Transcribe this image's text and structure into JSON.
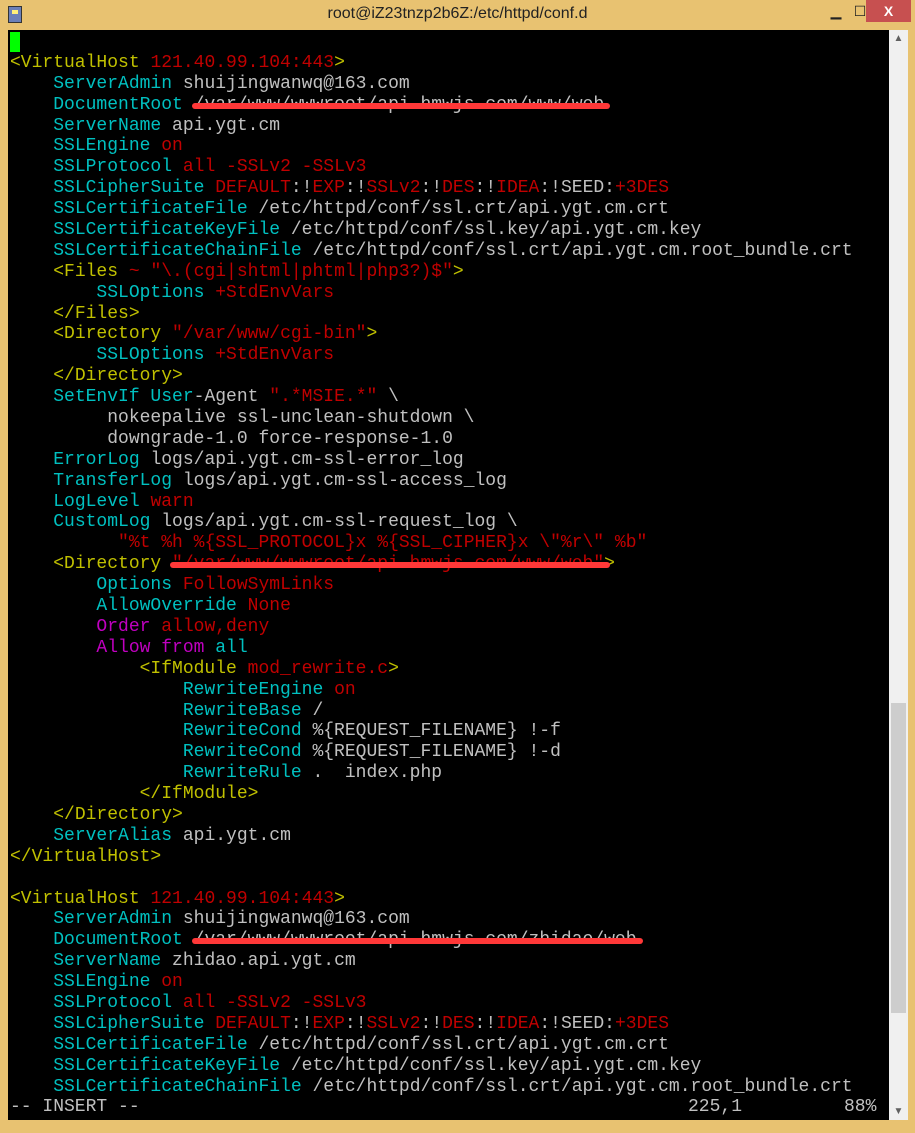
{
  "window": {
    "title": "root@iZ23tnzp2b6Z:/etc/httpd/conf.d",
    "min": "▁",
    "max": "☐",
    "close": "X"
  },
  "colors": {
    "yellow": "#c0c000",
    "red": "#c00000",
    "cyan": "#00c0c0",
    "magenta": "#c000c0",
    "white": "#c0c0c0",
    "cursor": "#00ff00",
    "titlebar": "#e8c271"
  },
  "lines": [
    [
      {
        "c": "cursor",
        "t": ""
      }
    ],
    [
      {
        "c": "y",
        "t": "<VirtualHost "
      },
      {
        "c": "r",
        "t": "121.40.99.104:443"
      },
      {
        "c": "y",
        "t": ">"
      }
    ],
    [
      {
        "c": "w",
        "t": "    "
      },
      {
        "c": "c",
        "t": "ServerAdmin"
      },
      {
        "c": "w",
        "t": " shuijingwanwq@163.com"
      }
    ],
    [
      {
        "c": "w",
        "t": "    "
      },
      {
        "c": "c",
        "t": "DocumentRoot"
      },
      {
        "c": "w",
        "t": " "
      },
      {
        "c": "w red",
        "t": "/var/www/wwwroot/api.hmwjs.com/www/web"
      }
    ],
    [
      {
        "c": "w",
        "t": "    "
      },
      {
        "c": "c",
        "t": "ServerName"
      },
      {
        "c": "w",
        "t": " api.ygt.cm"
      }
    ],
    [
      {
        "c": "w",
        "t": "    "
      },
      {
        "c": "c",
        "t": "SSLEngine"
      },
      {
        "c": "r",
        "t": " on"
      }
    ],
    [
      {
        "c": "w",
        "t": "    "
      },
      {
        "c": "c",
        "t": "SSLProtocol"
      },
      {
        "c": "r",
        "t": " all -SSLv2 -SSLv3"
      }
    ],
    [
      {
        "c": "w",
        "t": "    "
      },
      {
        "c": "c",
        "t": "SSLCipherSuite"
      },
      {
        "c": "r",
        "t": " DEFAULT"
      },
      {
        "c": "w",
        "t": ":!"
      },
      {
        "c": "r",
        "t": "EXP"
      },
      {
        "c": "w",
        "t": ":!"
      },
      {
        "c": "r",
        "t": "SSLv2"
      },
      {
        "c": "w",
        "t": ":!"
      },
      {
        "c": "r",
        "t": "DES"
      },
      {
        "c": "w",
        "t": ":!"
      },
      {
        "c": "r",
        "t": "IDEA"
      },
      {
        "c": "w",
        "t": ":!SEED:"
      },
      {
        "c": "r",
        "t": "+3DES"
      }
    ],
    [
      {
        "c": "w",
        "t": "    "
      },
      {
        "c": "c",
        "t": "SSLCertificateFile"
      },
      {
        "c": "w",
        "t": " /etc/httpd/conf/ssl.crt/api.ygt.cm.crt"
      }
    ],
    [
      {
        "c": "w",
        "t": "    "
      },
      {
        "c": "c",
        "t": "SSLCertificateKeyFile"
      },
      {
        "c": "w",
        "t": " /etc/httpd/conf/ssl.key/api.ygt.cm.key"
      }
    ],
    [
      {
        "c": "w",
        "t": "    "
      },
      {
        "c": "c",
        "t": "SSLCertificateChainFile"
      },
      {
        "c": "w",
        "t": " /etc/httpd/conf/ssl.crt/api.ygt.cm.root_bundle.crt"
      }
    ],
    [
      {
        "c": "w",
        "t": "    "
      },
      {
        "c": "y",
        "t": "<Files "
      },
      {
        "c": "r",
        "t": "~ \"\\.(cgi|shtml|phtml|php3?)$\""
      },
      {
        "c": "y",
        "t": ">"
      }
    ],
    [
      {
        "c": "w",
        "t": "        "
      },
      {
        "c": "c",
        "t": "SSLOptions"
      },
      {
        "c": "r",
        "t": " +StdEnvVars"
      }
    ],
    [
      {
        "c": "w",
        "t": "    "
      },
      {
        "c": "y",
        "t": "</Files>"
      }
    ],
    [
      {
        "c": "w",
        "t": "    "
      },
      {
        "c": "y",
        "t": "<Directory "
      },
      {
        "c": "r",
        "t": "\"/var/www/cgi-bin\""
      },
      {
        "c": "y",
        "t": ">"
      }
    ],
    [
      {
        "c": "w",
        "t": "        "
      },
      {
        "c": "c",
        "t": "SSLOptions"
      },
      {
        "c": "r",
        "t": " +StdEnvVars"
      }
    ],
    [
      {
        "c": "w",
        "t": "    "
      },
      {
        "c": "y",
        "t": "</Directory>"
      }
    ],
    [
      {
        "c": "w",
        "t": "    "
      },
      {
        "c": "c",
        "t": "SetEnvIf User"
      },
      {
        "c": "w",
        "t": "-Agent "
      },
      {
        "c": "r",
        "t": "\".*MSIE.*\""
      },
      {
        "c": "w",
        "t": " \\"
      }
    ],
    [
      {
        "c": "w",
        "t": "         nokeepalive ssl-unclean-shutdown \\"
      }
    ],
    [
      {
        "c": "w",
        "t": "         downgrade-1.0 force-response-1.0"
      }
    ],
    [
      {
        "c": "w",
        "t": "    "
      },
      {
        "c": "c",
        "t": "ErrorLog"
      },
      {
        "c": "w",
        "t": " logs/api.ygt.cm-ssl-error_log"
      }
    ],
    [
      {
        "c": "w",
        "t": "    "
      },
      {
        "c": "c",
        "t": "TransferLog"
      },
      {
        "c": "w",
        "t": " logs/api.ygt.cm-ssl-access_log"
      }
    ],
    [
      {
        "c": "w",
        "t": "    "
      },
      {
        "c": "c",
        "t": "LogLevel"
      },
      {
        "c": "r",
        "t": " warn"
      }
    ],
    [
      {
        "c": "w",
        "t": "    "
      },
      {
        "c": "c",
        "t": "CustomLog"
      },
      {
        "c": "w",
        "t": " logs/api.ygt.cm-ssl-request_log \\"
      }
    ],
    [
      {
        "c": "w",
        "t": "          "
      },
      {
        "c": "r",
        "t": "\"%t %h %{SSL_PROTOCOL}x %{SSL_CIPHER}x \\\"%r\\\" %b\""
      }
    ],
    [
      {
        "c": "w",
        "t": "    "
      },
      {
        "c": "y",
        "t": "<Directory "
      },
      {
        "c": "r red",
        "t": "\"/var/www/wwwroot/api.hmwjs.com/www/web\""
      },
      {
        "c": "y",
        "t": ">"
      }
    ],
    [
      {
        "c": "w",
        "t": "        "
      },
      {
        "c": "c",
        "t": "Options"
      },
      {
        "c": "r",
        "t": " FollowSymLinks"
      }
    ],
    [
      {
        "c": "w",
        "t": "        "
      },
      {
        "c": "c",
        "t": "AllowOverride"
      },
      {
        "c": "r",
        "t": " None"
      }
    ],
    [
      {
        "c": "w",
        "t": "        "
      },
      {
        "c": "m",
        "t": "Order"
      },
      {
        "c": "r",
        "t": " allow,deny"
      }
    ],
    [
      {
        "c": "w",
        "t": "        "
      },
      {
        "c": "m",
        "t": "Allow from"
      },
      {
        "c": "c",
        "t": " all"
      }
    ],
    [
      {
        "c": "w",
        "t": "            "
      },
      {
        "c": "y",
        "t": "<IfModule "
      },
      {
        "c": "r",
        "t": "mod_rewrite.c"
      },
      {
        "c": "y",
        "t": ">"
      }
    ],
    [
      {
        "c": "w",
        "t": "                "
      },
      {
        "c": "c",
        "t": "RewriteEngine"
      },
      {
        "c": "r",
        "t": " on"
      }
    ],
    [
      {
        "c": "w",
        "t": "                "
      },
      {
        "c": "c",
        "t": "RewriteBase"
      },
      {
        "c": "w",
        "t": " /"
      }
    ],
    [
      {
        "c": "w",
        "t": "                "
      },
      {
        "c": "c",
        "t": "RewriteCond"
      },
      {
        "c": "w",
        "t": " %{REQUEST_FILENAME} !-f"
      }
    ],
    [
      {
        "c": "w",
        "t": "                "
      },
      {
        "c": "c",
        "t": "RewriteCond"
      },
      {
        "c": "w",
        "t": " %{REQUEST_FILENAME} !-d"
      }
    ],
    [
      {
        "c": "w",
        "t": "                "
      },
      {
        "c": "c",
        "t": "RewriteRule"
      },
      {
        "c": "w",
        "t": " .  index.php"
      }
    ],
    [
      {
        "c": "w",
        "t": "            "
      },
      {
        "c": "y",
        "t": "</IfModule>"
      }
    ],
    [
      {
        "c": "w",
        "t": "    "
      },
      {
        "c": "y",
        "t": "</Directory>"
      }
    ],
    [
      {
        "c": "w",
        "t": "    "
      },
      {
        "c": "c",
        "t": "ServerAlias"
      },
      {
        "c": "w",
        "t": " api.ygt.cm"
      }
    ],
    [
      {
        "c": "y",
        "t": "</VirtualHost>"
      }
    ],
    [
      {
        "c": "w",
        "t": ""
      }
    ],
    [
      {
        "c": "y",
        "t": "<VirtualHost "
      },
      {
        "c": "r",
        "t": "121.40.99.104:443"
      },
      {
        "c": "y",
        "t": ">"
      }
    ],
    [
      {
        "c": "w",
        "t": "    "
      },
      {
        "c": "c",
        "t": "ServerAdmin"
      },
      {
        "c": "w",
        "t": " shuijingwanwq@163.com"
      }
    ],
    [
      {
        "c": "w",
        "t": "    "
      },
      {
        "c": "c",
        "t": "DocumentRoot"
      },
      {
        "c": "w",
        "t": " "
      },
      {
        "c": "w red",
        "t": "/var/www/wwwroot/api.hmwjs.com/zhidao/web"
      }
    ],
    [
      {
        "c": "w",
        "t": "    "
      },
      {
        "c": "c",
        "t": "ServerName"
      },
      {
        "c": "w",
        "t": " zhidao.api.ygt.cm"
      }
    ],
    [
      {
        "c": "w",
        "t": "    "
      },
      {
        "c": "c",
        "t": "SSLEngine"
      },
      {
        "c": "r",
        "t": " on"
      }
    ],
    [
      {
        "c": "w",
        "t": "    "
      },
      {
        "c": "c",
        "t": "SSLProtocol"
      },
      {
        "c": "r",
        "t": " all -SSLv2 -SSLv3"
      }
    ],
    [
      {
        "c": "w",
        "t": "    "
      },
      {
        "c": "c",
        "t": "SSLCipherSuite"
      },
      {
        "c": "r",
        "t": " DEFAULT"
      },
      {
        "c": "w",
        "t": ":!"
      },
      {
        "c": "r",
        "t": "EXP"
      },
      {
        "c": "w",
        "t": ":!"
      },
      {
        "c": "r",
        "t": "SSLv2"
      },
      {
        "c": "w",
        "t": ":!"
      },
      {
        "c": "r",
        "t": "DES"
      },
      {
        "c": "w",
        "t": ":!"
      },
      {
        "c": "r",
        "t": "IDEA"
      },
      {
        "c": "w",
        "t": ":!SEED:"
      },
      {
        "c": "r",
        "t": "+3DES"
      }
    ],
    [
      {
        "c": "w",
        "t": "    "
      },
      {
        "c": "c",
        "t": "SSLCertificateFile"
      },
      {
        "c": "w",
        "t": " /etc/httpd/conf/ssl.crt/api.ygt.cm.crt"
      }
    ],
    [
      {
        "c": "w",
        "t": "    "
      },
      {
        "c": "c",
        "t": "SSLCertificateKeyFile"
      },
      {
        "c": "w",
        "t": " /etc/httpd/conf/ssl.key/api.ygt.cm.key"
      }
    ],
    [
      {
        "c": "w",
        "t": "    "
      },
      {
        "c": "c",
        "t": "SSLCertificateChainFile"
      },
      {
        "c": "w",
        "t": " /etc/httpd/conf/ssl.crt/api.ygt.cm.root_bundle.crt"
      }
    ]
  ],
  "status": {
    "mode": "-- INSERT --",
    "position": "225,1",
    "percent": "88%"
  },
  "scrollbar": {
    "up": "▲",
    "down": "▼",
    "scroll_fraction": 0.88
  }
}
